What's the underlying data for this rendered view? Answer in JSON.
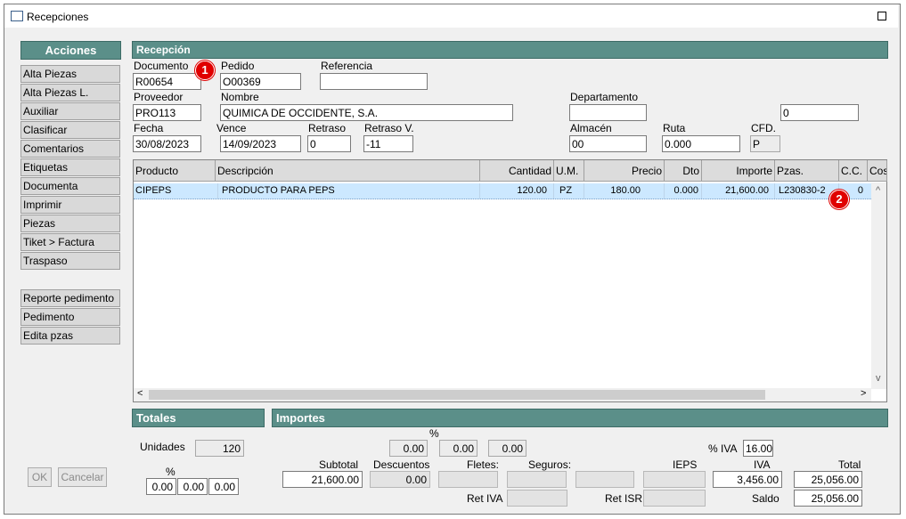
{
  "window": {
    "title": "Recepciones"
  },
  "sidebar": {
    "header": "Acciones",
    "items": [
      "Alta Piezas",
      "Alta Piezas L.",
      "Auxiliar",
      "Clasificar",
      "Comentarios",
      "Etiquetas",
      "Documenta",
      "Imprimir",
      "Piezas",
      "Tiket > Factura",
      "Traspaso"
    ],
    "items2": [
      "Reporte pedimento",
      "Pedimento",
      "Edita pzas"
    ]
  },
  "reception": {
    "header": "Recepción",
    "documento": {
      "label": "Documento",
      "value": "R00654"
    },
    "pedido": {
      "label": "Pedido",
      "value": "O00369"
    },
    "referencia": {
      "label": "Referencia",
      "value": ""
    },
    "proveedor": {
      "label": "Proveedor",
      "value": "PRO113"
    },
    "nombre": {
      "label": "Nombre",
      "value": "QUIMICA DE OCCIDENTE, S.A."
    },
    "departamento": {
      "label": "Departamento",
      "value": "",
      "extra": "0"
    },
    "fecha": {
      "label": "Fecha",
      "value": "30/08/2023"
    },
    "vence": {
      "label": "Vence",
      "value": "14/09/2023"
    },
    "retraso": {
      "label": "Retraso",
      "value": "0"
    },
    "retraso_v": {
      "label": "Retraso V.",
      "value": "-11"
    },
    "almacen": {
      "label": "Almacén",
      "value": "00"
    },
    "ruta": {
      "label": "Ruta",
      "value": "0.000"
    },
    "cfd": {
      "label": "CFD.",
      "value": "P"
    }
  },
  "badges": [
    "1",
    "2"
  ],
  "grid": {
    "columns": [
      "Producto",
      "Descripción",
      "Cantidad",
      "U.M.",
      "Precio",
      "Dto",
      "Importe",
      "Pzas.",
      "C.C.",
      "Cos"
    ],
    "rows": [
      {
        "producto": "CIPEPS",
        "descripcion": "PRODUCTO PARA PEPS",
        "cantidad": "120.00",
        "um": "PZ",
        "precio": "180.00",
        "dto": "0.000",
        "importe": "21,600.00",
        "pzas": "L230830-2",
        "cc": "0"
      }
    ],
    "scroll_left": "<",
    "scroll_right": ">",
    "scroll_up": "^",
    "scroll_down": "v"
  },
  "totales": {
    "header": "Totales",
    "unidades_label": "Unidades",
    "unidades": "120",
    "pct_label": "%",
    "pct": [
      "0.00",
      "0.00",
      "0.00"
    ]
  },
  "importes": {
    "header": "Importes",
    "pct_label": "%",
    "pct": [
      "0.00",
      "0.00",
      "0.00"
    ],
    "iva_pct_label": "% IVA",
    "iva_pct": "16.00",
    "subtotal_label": "Subtotal",
    "subtotal": "21,600.00",
    "descuentos_label": "Descuentos",
    "descuentos": "0.00",
    "fletes_label": "Fletes:",
    "fletes": "",
    "seguros_label": "Seguros:",
    "seguros": "",
    "extra": "",
    "ieps_label": "IEPS",
    "ieps": "",
    "iva_label": "IVA",
    "iva": "3,456.00",
    "total_label": "Total",
    "total": "25,056.00",
    "ret_iva_label": "Ret IVA",
    "ret_iva": "",
    "ret_isr_label": "Ret ISR",
    "ret_isr": "",
    "saldo_label": "Saldo",
    "saldo": "25,056.00"
  },
  "buttons": {
    "ok": "OK",
    "cancelar": "Cancelar"
  }
}
